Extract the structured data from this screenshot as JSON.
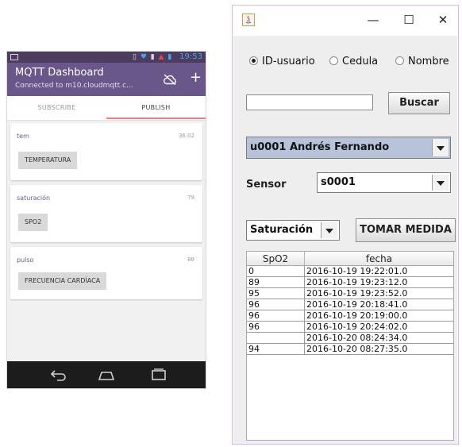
{
  "phone": {
    "status_time": "19:53",
    "app_title": "MQTT Dashboard",
    "app_subtitle": "Connected to m10.cloudmqtt.c...",
    "tabs": {
      "subscribe": "SUBSCRIBE",
      "publish": "PUBLISH"
    },
    "cards": [
      {
        "topic": "tem",
        "value": "36.02",
        "button": "TEMPERATURA"
      },
      {
        "topic": "saturación",
        "value": "79",
        "button": "SPO2"
      },
      {
        "topic": "pulso",
        "value": "88",
        "button": "FRECUENCIA CARDÍACA"
      }
    ],
    "colors": {
      "status_bar": "#4c3c60",
      "app_bar": "#6a578a",
      "tab_indicator": "#f08080",
      "nav_bar": "#1c1c1c"
    },
    "icons": [
      "cloud-off-icon",
      "plus-icon",
      "back-icon",
      "home-icon",
      "recent-apps-icon"
    ]
  },
  "window": {
    "controls": {
      "minimize": "—",
      "maximize": "☐",
      "close": "✕"
    },
    "search_options": [
      {
        "label": "ID-usuario",
        "selected": true
      },
      {
        "label": "Cedula",
        "selected": false
      },
      {
        "label": "Nombre",
        "selected": false
      }
    ],
    "search_value": "",
    "search_button": "Buscar",
    "user_select": "u0001 Andrés Fernando",
    "sensor_label": "Sensor",
    "sensor_select": "s0001",
    "measure_select": "Saturación",
    "measure_button": "TOMAR MEDIDA",
    "table": {
      "columns": [
        "SpO2",
        "fecha"
      ],
      "rows": [
        [
          "0",
          "2016-10-19 19:22:01.0"
        ],
        [
          "89",
          "2016-10-19 19:23:12.0"
        ],
        [
          "95",
          "2016-10-19 19:23:52.0"
        ],
        [
          "96",
          "2016-10-19 20:18:41.0"
        ],
        [
          "96",
          "2016-10-19 20:19:00.0"
        ],
        [
          "96",
          "2016-10-19 20:24:02.0"
        ],
        [
          "",
          "2016-10-20 08:24:34.0"
        ],
        [
          "94",
          "2016-10-20 08:27:35.0"
        ]
      ]
    },
    "colors": {
      "user_select_bg": "#b6c3d9",
      "frame_border": "#d9b7de"
    }
  }
}
